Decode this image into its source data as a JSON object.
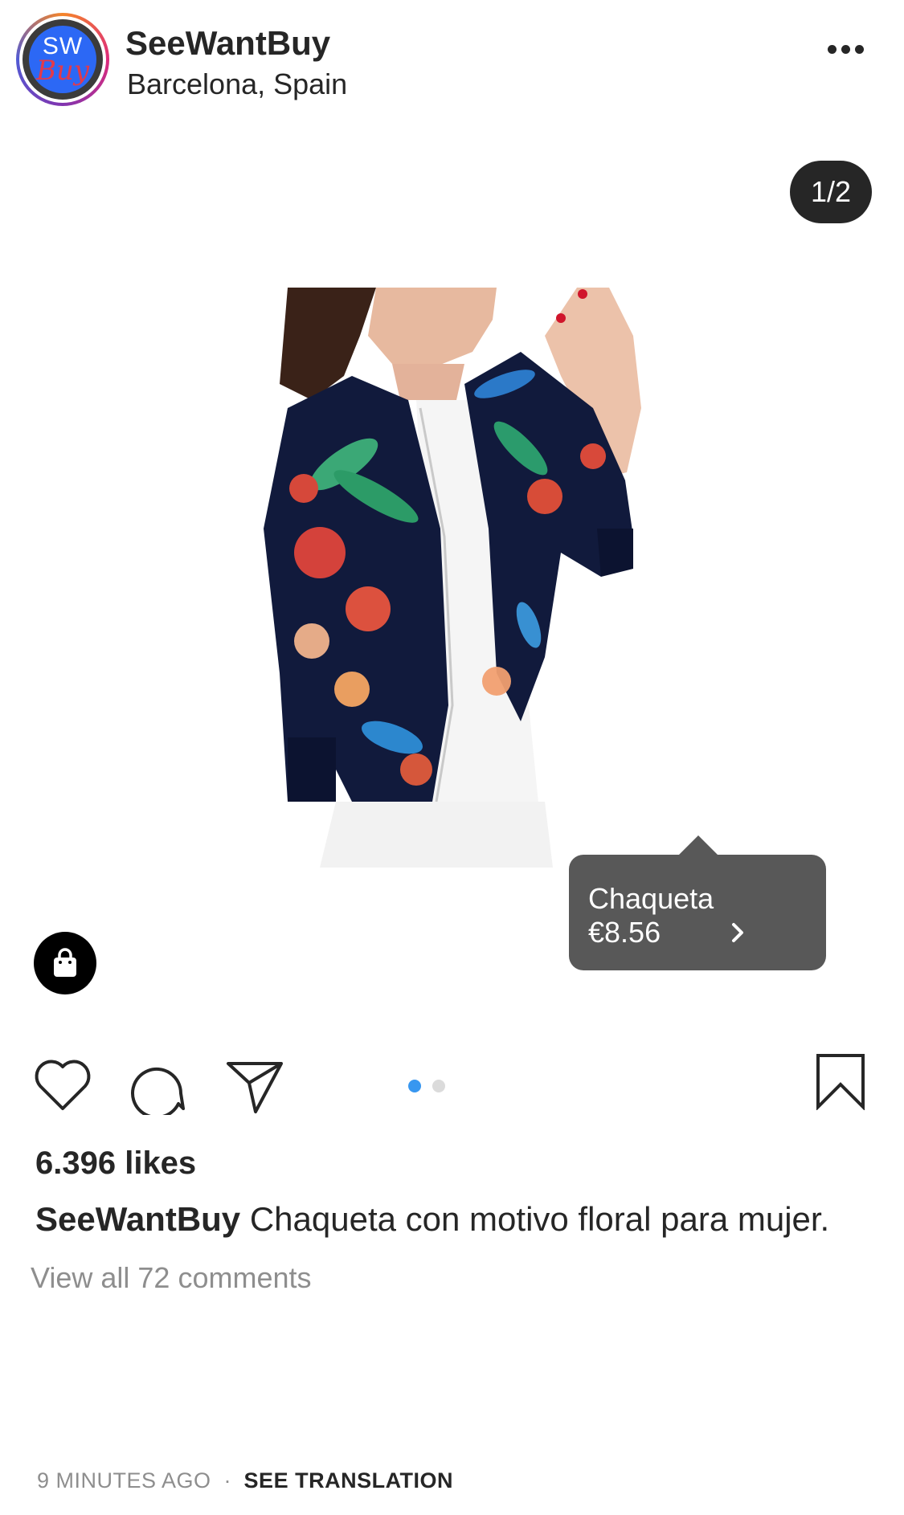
{
  "post": {
    "username": "SeeWantBuy",
    "location": "Barcelona, Spain",
    "avatar": {
      "logo_top": "SW",
      "logo_bottom": "Buy"
    },
    "more_icon": "more-horizontal-icon"
  },
  "media": {
    "counter": "1/2",
    "current_slide": 1,
    "total_slides": 2,
    "product_tag": {
      "name": "Chaqueta",
      "price": "€8.56"
    },
    "shop_icon": "shopping-bag-icon"
  },
  "actions": {
    "like_icon": "heart-icon",
    "comment_icon": "comment-bubble-icon",
    "share_icon": "send-plane-icon",
    "save_icon": "bookmark-icon",
    "active_dot_color": "#3897f0",
    "inactive_dot_color": "#dbdbdb"
  },
  "stats": {
    "likes": "6.396 likes"
  },
  "caption": {
    "author": "SeeWantBuy",
    "text": "Chaqueta con motivo floral para mujer."
  },
  "comments": {
    "view_all": "View all 72 comments"
  },
  "footer": {
    "time_ago": "9 MINUTES AGO",
    "separator": "·",
    "translate_label": "SEE TRANSLATION"
  }
}
